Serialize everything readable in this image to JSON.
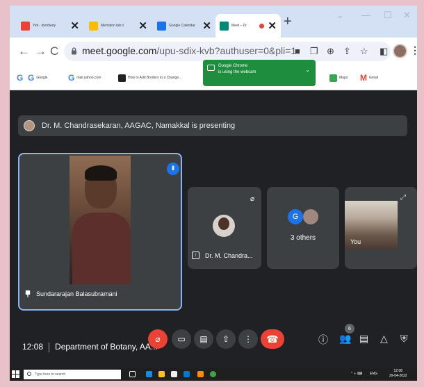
{
  "browser": {
    "tabs": [
      {
        "title": "Yeti - dumbedy",
        "color": "#ea4335"
      },
      {
        "title": "Mematon lab ti",
        "color": "#fbbc04"
      },
      {
        "title": "Google Calendar",
        "color": "#1a73e8"
      },
      {
        "title": "Meet – Dr",
        "color": "#00897b"
      }
    ],
    "new_tab_label": "+",
    "url_host": "meet.google.com",
    "url_path": "/upu-sdix-kvb?authuser=0&pli=1",
    "bookmarks": [
      {
        "label": "Google",
        "icon": "G"
      },
      {
        "label": "mail.yahoo.com",
        "icon": "G"
      },
      {
        "label": "How to Add Borders to a Change...",
        "icon": "square"
      },
      {
        "label": "Maps",
        "icon": "pin"
      },
      {
        "label": "Gmail",
        "icon": "M"
      }
    ],
    "webcam_notice": {
      "line1": "Google Chrome",
      "line2": "is using the webcam"
    }
  },
  "meet": {
    "presenting_banner": "Dr. M. Chandrasekaran, AAGAC, Namakkal is presenting",
    "main_participant": "Sundararajan Balasubramani",
    "tiles": [
      {
        "name": "Dr. M. Chandra..."
      },
      {
        "label": "3 others",
        "avatar_letter": "G"
      },
      {
        "name": "You"
      }
    ],
    "time": "12:08",
    "meeting_name": "Department of Botany, AA...",
    "participant_count": "6"
  },
  "taskbar": {
    "search_placeholder": "Type here to search",
    "lang": "ENG",
    "clock_time": "12:08",
    "clock_date": "29-04-2022"
  },
  "colors": {
    "meet_bg": "#202124",
    "tile_bg": "#3c4043",
    "end_call": "#ea4335",
    "active_border": "#8ab4f8"
  }
}
